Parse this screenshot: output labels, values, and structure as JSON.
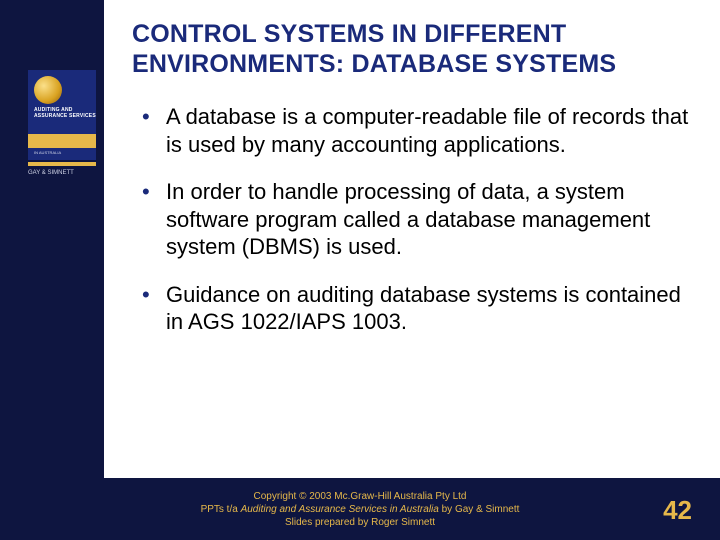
{
  "title": "CONTROL SYSTEMS IN DIFFERENT ENVIRONMENTS: DATABASE SYSTEMS",
  "bullets": [
    "A database is a computer-readable file of records that is used by many accounting applications.",
    "In order to handle processing of data, a system software program called a database management system (DBMS) is used.",
    "Guidance on auditing database systems is contained in AGS 1022/IAPS 1003."
  ],
  "cover": {
    "line1": "AUDITING",
    "line2": "ASSURANCE SERVICES",
    "sub": "IN AUSTRALIA",
    "author": "GAY & SIMNETT"
  },
  "footer": {
    "line1_a": "Copyright ",
    "line1_b": " 2003 Mc.Graw-Hill Australia Pty Ltd",
    "line2_a": "PPTs t/a ",
    "line2_b": "Auditing and Assurance Services in Australia ",
    "line2_c": "by Gay & Simnett",
    "line3": "Slides prepared by Roger Simnett"
  },
  "slide_number": "42"
}
